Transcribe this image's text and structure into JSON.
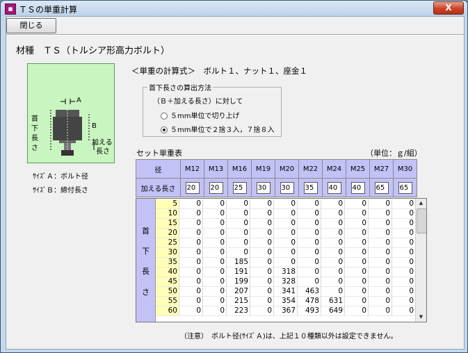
{
  "window": {
    "title": "ＴＳの単重計算",
    "close_glyph": "X"
  },
  "toolbar": {
    "close_button": "閉じる"
  },
  "material": "材種　ＴＳ（トルシア形高力ボルト）",
  "diagram": {
    "label_a": "A",
    "label_b": "B",
    "neck_length_label": [
      "首",
      "下",
      "長",
      "さ"
    ],
    "added_length_label": [
      "加える",
      "長さ"
    ]
  },
  "notes": {
    "size_a": "ｻｲｽﾞＡ：ボルト径",
    "size_b": "ｻｲｽﾞＢ：締付長さ"
  },
  "formula": "＜単重の計算式＞　ボルト１、ナット１、座金１",
  "calc_method": {
    "legend": "首下長さの算出方法",
    "description": "（Ｂ＋加える長さ）に対して",
    "options": [
      {
        "label": "５mm単位で切り上げ",
        "selected": false
      },
      {
        "label": "５mm単位で２捨３入，７捨８入",
        "selected": true
      }
    ]
  },
  "set_table": {
    "title": "セット単重表",
    "unit": "（単位：ｇ/組）",
    "diameter_label": "径",
    "add_length_label": "加える長さ",
    "diameters": [
      "M12",
      "M13",
      "M16",
      "M19",
      "M20",
      "M22",
      "M24",
      "M25",
      "M27",
      "M30"
    ],
    "add_lengths": [
      "20",
      "20",
      "25",
      "30",
      "30",
      "35",
      "40",
      "40",
      "65",
      "65"
    ],
    "side_label": [
      "首",
      "下",
      "長",
      "さ"
    ],
    "rows": [
      {
        "length": "5",
        "values": [
          "0",
          "0",
          "0",
          "0",
          "0",
          "0",
          "0",
          "0",
          "0",
          "0"
        ]
      },
      {
        "length": "10",
        "values": [
          "0",
          "0",
          "0",
          "0",
          "0",
          "0",
          "0",
          "0",
          "0",
          "0"
        ]
      },
      {
        "length": "15",
        "values": [
          "0",
          "0",
          "0",
          "0",
          "0",
          "0",
          "0",
          "0",
          "0",
          "0"
        ]
      },
      {
        "length": "20",
        "values": [
          "0",
          "0",
          "0",
          "0",
          "0",
          "0",
          "0",
          "0",
          "0",
          "0"
        ]
      },
      {
        "length": "25",
        "values": [
          "0",
          "0",
          "0",
          "0",
          "0",
          "0",
          "0",
          "0",
          "0",
          "0"
        ]
      },
      {
        "length": "30",
        "values": [
          "0",
          "0",
          "0",
          "0",
          "0",
          "0",
          "0",
          "0",
          "0",
          "0"
        ]
      },
      {
        "length": "35",
        "values": [
          "0",
          "0",
          "185",
          "0",
          "0",
          "0",
          "0",
          "0",
          "0",
          "0"
        ]
      },
      {
        "length": "40",
        "values": [
          "0",
          "0",
          "191",
          "0",
          "318",
          "0",
          "0",
          "0",
          "0",
          "0"
        ]
      },
      {
        "length": "45",
        "values": [
          "0",
          "0",
          "199",
          "0",
          "328",
          "0",
          "0",
          "0",
          "0",
          "0"
        ]
      },
      {
        "length": "50",
        "values": [
          "0",
          "0",
          "207",
          "0",
          "341",
          "463",
          "0",
          "0",
          "0",
          "0"
        ]
      },
      {
        "length": "55",
        "values": [
          "0",
          "0",
          "215",
          "0",
          "354",
          "478",
          "631",
          "0",
          "0",
          "0"
        ]
      },
      {
        "length": "60",
        "values": [
          "0",
          "0",
          "223",
          "0",
          "367",
          "493",
          "649",
          "0",
          "0",
          "0"
        ]
      }
    ]
  },
  "footnote": "（注意）　ボルト径(ｻｲｽﾞＡ)は、上記１０種類以外は設定できません。"
}
